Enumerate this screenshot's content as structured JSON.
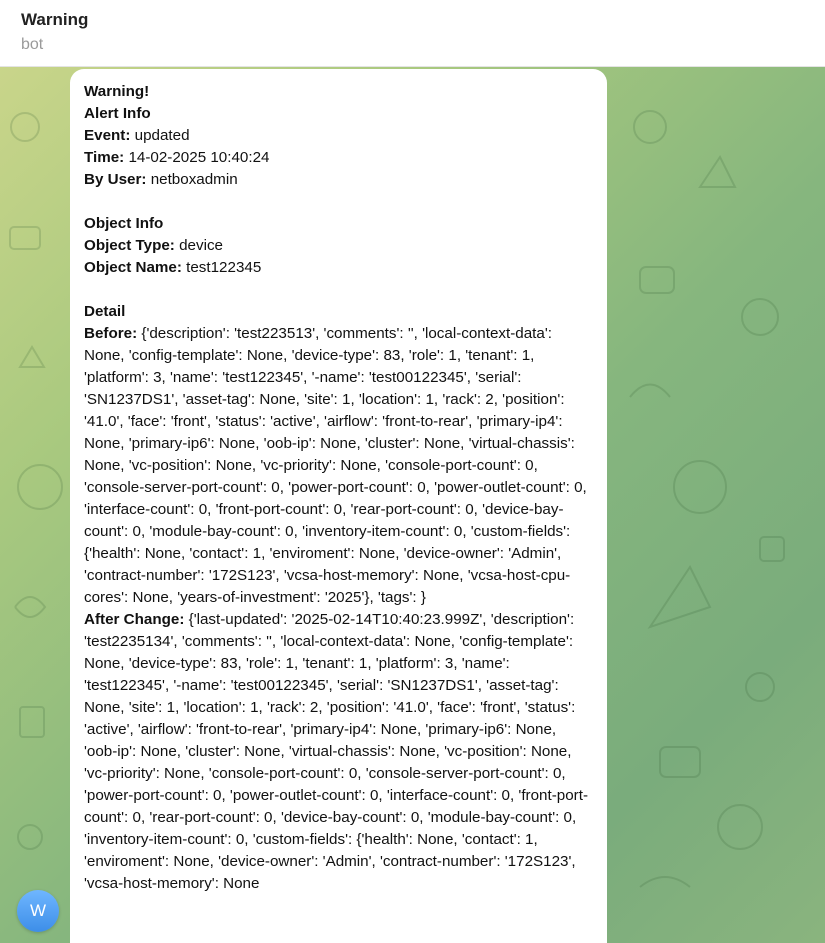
{
  "header": {
    "title": "Warning",
    "subtitle": "bot"
  },
  "avatar": {
    "initial": "W"
  },
  "message": {
    "title": "Warning!",
    "alert_heading": "Alert Info",
    "event_label": "Event:",
    "event_value": " updated",
    "time_label": "Time:",
    "time_value": " 14-02-2025 10:40:24",
    "user_label": "By User:",
    "user_value": " netboxadmin",
    "object_heading": "Object Info",
    "object_type_label": "Object Type:",
    "object_type_value": " device",
    "object_name_label": "Object Name:",
    "object_name_value": " test122345",
    "detail_heading": "Detail",
    "before_label": "Before:",
    "before_value": " {'description': 'test223513', 'comments': '', 'local-context-data': None, 'config-template': None, 'device-type': 83, 'role': 1, 'tenant': 1, 'platform': 3, 'name': 'test122345', '-name': 'test00122345', 'serial': 'SN1237DS1', 'asset-tag': None, 'site': 1, 'location': 1, 'rack': 2, 'position': '41.0', 'face': 'front', 'status': 'active', 'airflow': 'front-to-rear', 'primary-ip4': None, 'primary-ip6': None, 'oob-ip': None, 'cluster': None, 'virtual-chassis': None, 'vc-position': None, 'vc-priority': None, 'console-port-count': 0, 'console-server-port-count': 0, 'power-port-count': 0, 'power-outlet-count': 0, 'interface-count': 0, 'front-port-count': 0, 'rear-port-count': 0, 'device-bay-count': 0, 'module-bay-count': 0, 'inventory-item-count': 0, 'custom-fields': {'health': None, 'contact': 1, 'enviroment': None, 'device-owner': 'Admin', 'contract-number': '172S123', 'vcsa-host-memory': None, 'vcsa-host-cpu-cores': None, 'years-of-investment': '2025'}, 'tags': }",
    "after_label": "After Change:",
    "after_value": " {'last-updated': '2025-02-14T10:40:23.999Z', 'description': 'test2235134', 'comments': '', 'local-context-data': None, 'config-template': None, 'device-type': 83, 'role': 1, 'tenant': 1, 'platform': 3, 'name': 'test122345', '-name': 'test00122345', 'serial': 'SN1237DS1', 'asset-tag': None, 'site': 1, 'location': 1, 'rack': 2, 'position': '41.0', 'face': 'front', 'status': 'active', 'airflow': 'front-to-rear', 'primary-ip4': None, 'primary-ip6': None, 'oob-ip': None, 'cluster': None, 'virtual-chassis': None, 'vc-position': None, 'vc-priority': None, 'console-port-count': 0, 'console-server-port-count': 0, 'power-port-count': 0, 'power-outlet-count': 0, 'interface-count': 0, 'front-port-count': 0, 'rear-port-count': 0, 'device-bay-count': 0, 'module-bay-count': 0, 'inventory-item-count': 0, 'custom-fields': {'health': None, 'contact': 1, 'enviroment': None, 'device-owner': 'Admin', 'contract-number': '172S123', 'vcsa-host-memory': None"
  }
}
